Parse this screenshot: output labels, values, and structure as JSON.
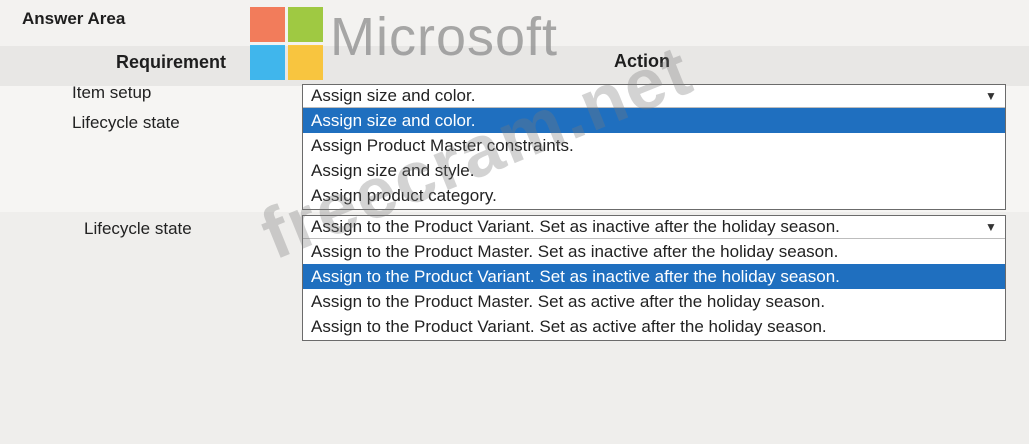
{
  "answer_area": {
    "title": "Answer Area"
  },
  "logo": {
    "word": "Microsoft",
    "colors": [
      "#f25022",
      "#7fba00",
      "#00a4ef",
      "#ffb900"
    ]
  },
  "headers": {
    "requirement": "Requirement",
    "action": "Action"
  },
  "rows": [
    {
      "requirement": "Item setup",
      "dropdown": {
        "selected_value": "Assign size and color.",
        "options": [
          "Assign size and color.",
          "Assign Product Master constraints.",
          "Assign size and style.",
          "Assign product category."
        ],
        "highlighted_option": "Assign size and color."
      }
    },
    {
      "requirement": "Lifecycle state"
    },
    {
      "requirement": "Lifecycle state",
      "dropdown": {
        "selected_value": "Assign to the Product Variant. Set as inactive after the holiday season.",
        "options": [
          "Assign to the Product Master. Set as inactive after the holiday season.",
          "Assign to the Product Variant. Set as inactive after the holiday season.",
          "Assign to the Product Master. Set as active after the holiday season.",
          "Assign to the Product Variant. Set as active after the holiday season."
        ],
        "highlighted_option": "Assign to the Product Variant. Set as inactive after the holiday season."
      }
    }
  ],
  "watermark": {
    "text": "freecram.net"
  },
  "colors": {
    "highlight": "#1f6fbf",
    "highlight_text": "#ffffff"
  }
}
